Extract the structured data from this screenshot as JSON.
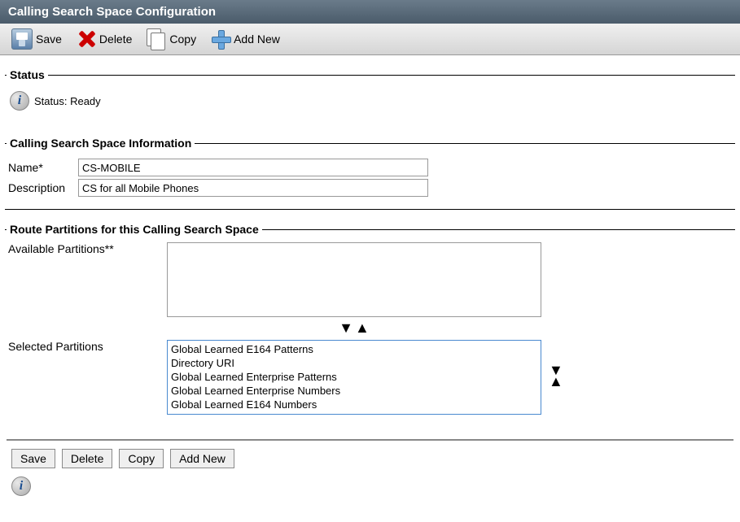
{
  "header": {
    "title": "Calling Search Space Configuration"
  },
  "toolbar": {
    "save": "Save",
    "delete": "Delete",
    "copy": "Copy",
    "addnew": "Add New"
  },
  "status": {
    "legend": "Status",
    "text": "Status: Ready"
  },
  "info": {
    "legend": "Calling Search Space Information",
    "name_label": "Name*",
    "name_value": "CS-MOBILE",
    "desc_label": "Description",
    "desc_value": "CS for all Mobile Phones"
  },
  "partitions": {
    "legend": "Route Partitions for this Calling Search Space",
    "available_label": "Available Partitions**",
    "selected_label": "Selected Partitions",
    "available": [],
    "selected": [
      "Global Learned E164 Patterns",
      "Directory URI",
      "Global Learned Enterprise Patterns",
      "Global Learned Enterprise Numbers",
      "Global Learned E164 Numbers"
    ]
  },
  "buttons": {
    "save": "Save",
    "delete": "Delete",
    "copy": "Copy",
    "addnew": "Add New"
  }
}
